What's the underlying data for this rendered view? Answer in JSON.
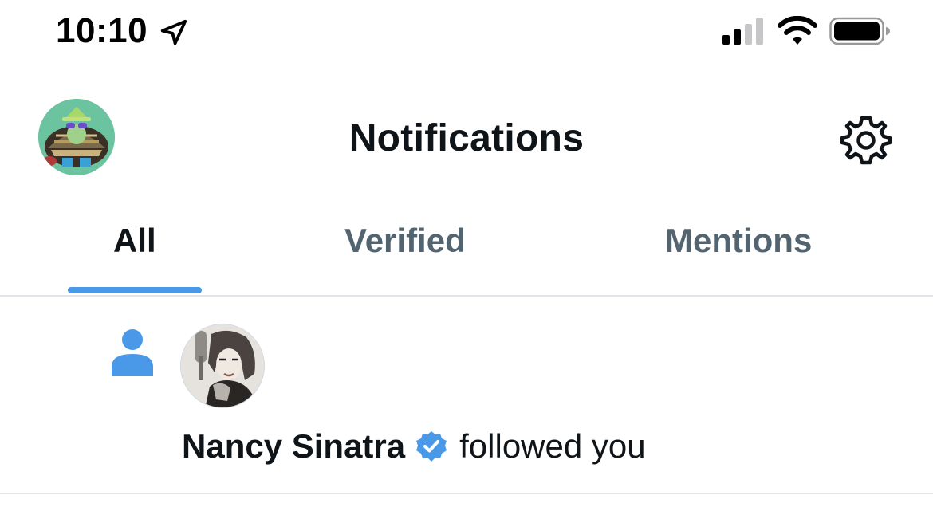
{
  "status_bar": {
    "time": "10:10",
    "icons": [
      "location-arrow-icon",
      "cellular-signal-icon",
      "wifi-icon",
      "battery-icon"
    ]
  },
  "header": {
    "title": "Notifications",
    "avatar": "profile-avatar",
    "settings_icon": "gear-icon"
  },
  "tabs": [
    {
      "label": "All",
      "active": true
    },
    {
      "label": "Verified",
      "active": false
    },
    {
      "label": "Mentions",
      "active": false
    }
  ],
  "notifications": [
    {
      "type": "follow",
      "icon": "person-icon",
      "name": "Nancy Sinatra",
      "verified": true,
      "action": "followed you"
    }
  ],
  "colors": {
    "accent": "#4a99e9",
    "text_primary": "#0f1419",
    "text_secondary": "#536471",
    "divider": "#e1e4e8"
  }
}
